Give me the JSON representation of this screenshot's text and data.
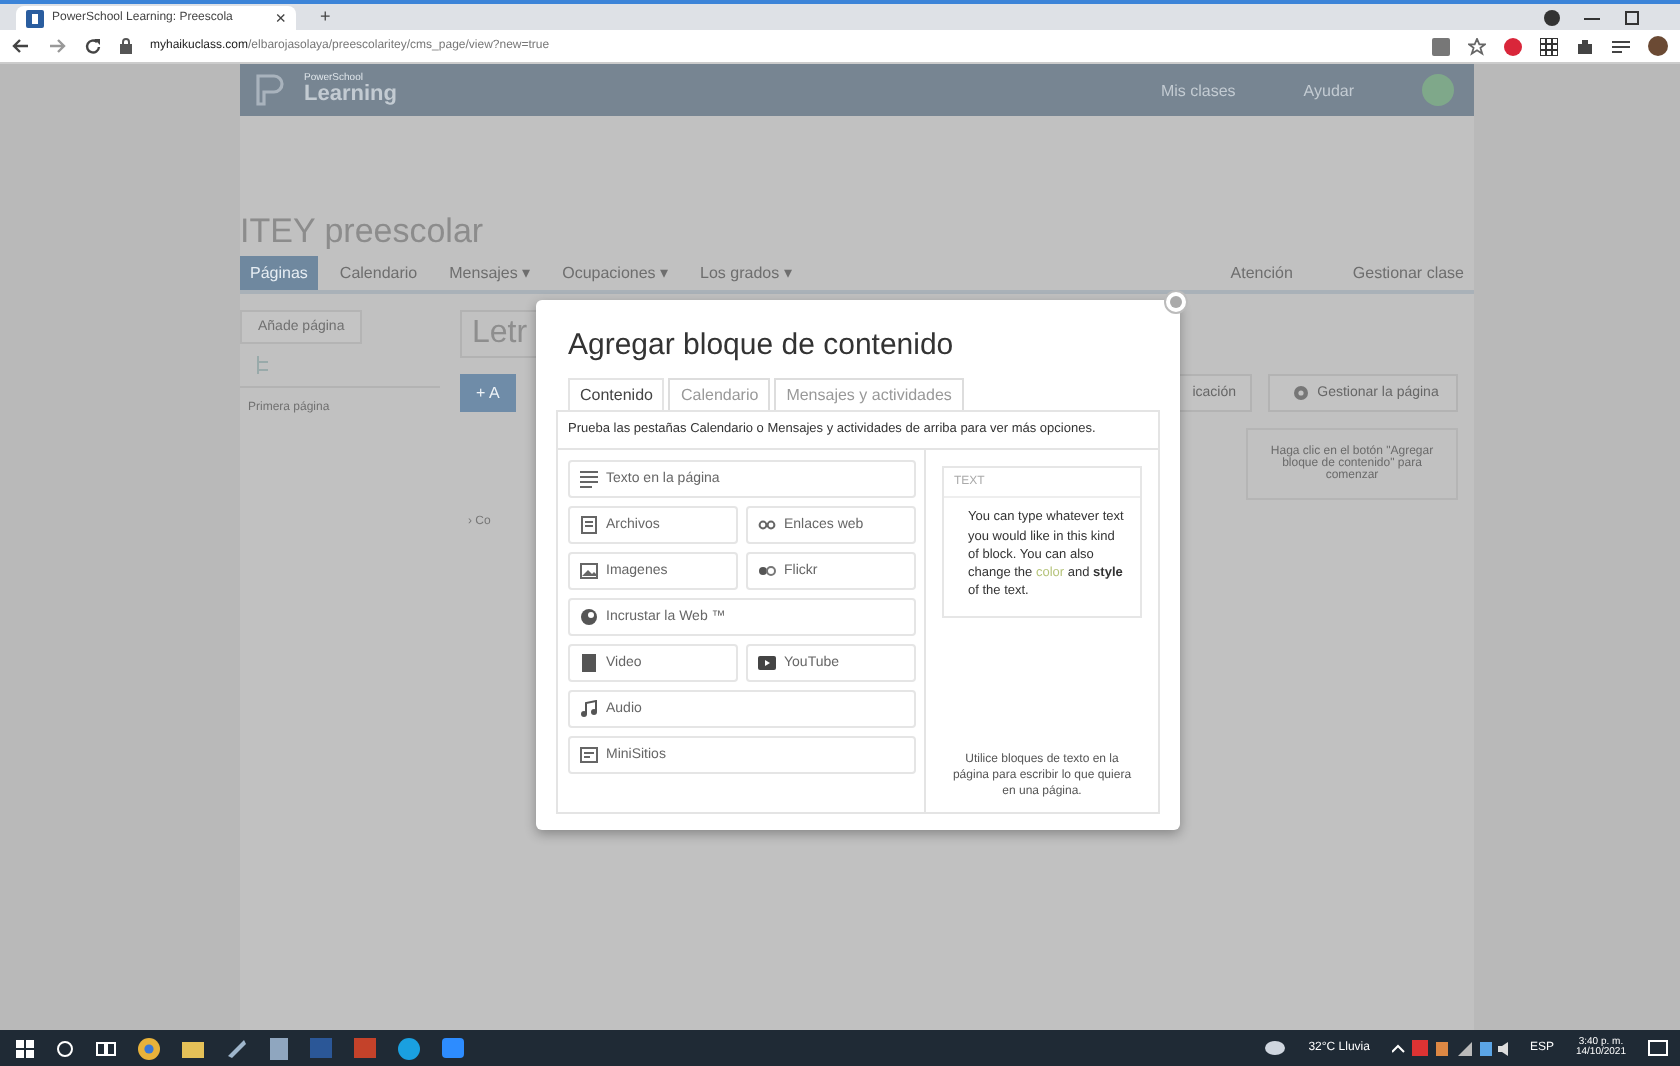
{
  "browser": {
    "tab_title": "PowerSchool Learning: Preescola",
    "tab_close": "×",
    "new_tab": "+",
    "url_host": "myhaikuclass.com",
    "url_path": "/elbarojasolaya/preescolaritey/cms_page/view?new=true"
  },
  "header": {
    "logo_small": "PowerSchool",
    "logo": "Learning",
    "links": [
      "Mis clases",
      "Ayudar"
    ]
  },
  "class_title": "ITEY preescolar",
  "nav": [
    {
      "label": "Páginas",
      "selected": true
    },
    {
      "label": "Calendario",
      "selected": false
    },
    {
      "label": "Mensajes ▾",
      "selected": false
    },
    {
      "label": "Ocupaciones ▾",
      "selected": false
    },
    {
      "label": "Los grados ▾",
      "selected": false
    }
  ],
  "nav_right": [
    "Atención",
    "Gestionar clase"
  ],
  "sidebar": {
    "add": "Añade página",
    "pages": [
      "Primera página"
    ]
  },
  "content": {
    "title_partial": "Letr",
    "add_partial": "+ A",
    "publish_partial": "icación",
    "manage": "Gestionar la página",
    "hint": "Haga clic en el botón \"Agregar bloque de contenido\" para comenzar",
    "section_partial": "› Co"
  },
  "modal": {
    "title": "Agregar bloque de contenido",
    "tabs": [
      {
        "label": "Contenido",
        "selected": true
      },
      {
        "label": "Calendario",
        "selected": false
      },
      {
        "label": "Mensajes y actividades",
        "selected": false
      }
    ],
    "intro": "Prueba las pestañas Calendario o Mensajes y actividades de arriba para ver más opciones.",
    "blocks": [
      {
        "label": "Texto en la página",
        "kind": "text",
        "wide": true
      },
      {
        "label": "Archivos",
        "kind": "file",
        "wide": false
      },
      {
        "label": "Enlaces web",
        "kind": "link",
        "wide": false
      },
      {
        "label": "Imagenes",
        "kind": "image",
        "wide": false
      },
      {
        "label": "Flickr",
        "kind": "flickr",
        "wide": false
      },
      {
        "label": "Incrustar la Web ™",
        "kind": "embed",
        "wide": true
      },
      {
        "label": "Video",
        "kind": "video",
        "wide": false
      },
      {
        "label": "YouTube",
        "kind": "youtube",
        "wide": false
      },
      {
        "label": "Audio",
        "kind": "audio",
        "wide": true
      },
      {
        "label": "MiniSitios",
        "kind": "minisite",
        "wide": true
      }
    ],
    "preview": {
      "label": "TEXT",
      "parts": [
        {
          "text": "You can type whatever text you would like in this kind of block. You can also change the ",
          "kind": "plain"
        },
        {
          "text": "color",
          "kind": "colored"
        },
        {
          "text": " and **style** of the text.",
          "kind": "plain"
        }
      ]
    },
    "description": "Utilice bloques de texto en la página para escribir lo que quiera en una página."
  },
  "taskbar": {
    "weather": "32°C Lluvia",
    "language": "ESP",
    "time": "3:40 p. m.",
    "date": "14/10/2021"
  }
}
